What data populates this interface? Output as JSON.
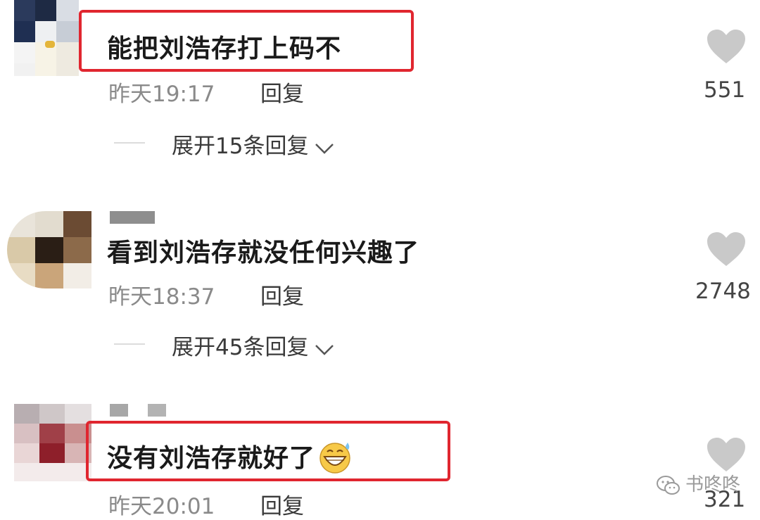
{
  "comments": [
    {
      "text": "能把刘浩存打上码不",
      "time": "昨天19:17",
      "reply_label": "回复",
      "likes": "551",
      "expand_label": "展开15条回复",
      "highlighted": true
    },
    {
      "text": "看到刘浩存就没任何兴趣了",
      "time": "昨天18:37",
      "reply_label": "回复",
      "likes": "2748",
      "expand_label": "展开45条回复",
      "highlighted": false
    },
    {
      "text": "没有刘浩存就好了",
      "time": "昨天20:01",
      "reply_label": "回复",
      "likes": "321",
      "highlighted": true,
      "emoji": "grinning-sweat-emoji"
    }
  ],
  "watermark": {
    "text": "书咚咚",
    "icon": "wechat-icon"
  },
  "colors": {
    "highlight": "#e0262f",
    "meta": "#8a8a8a",
    "heart": "#c9c9c9"
  }
}
